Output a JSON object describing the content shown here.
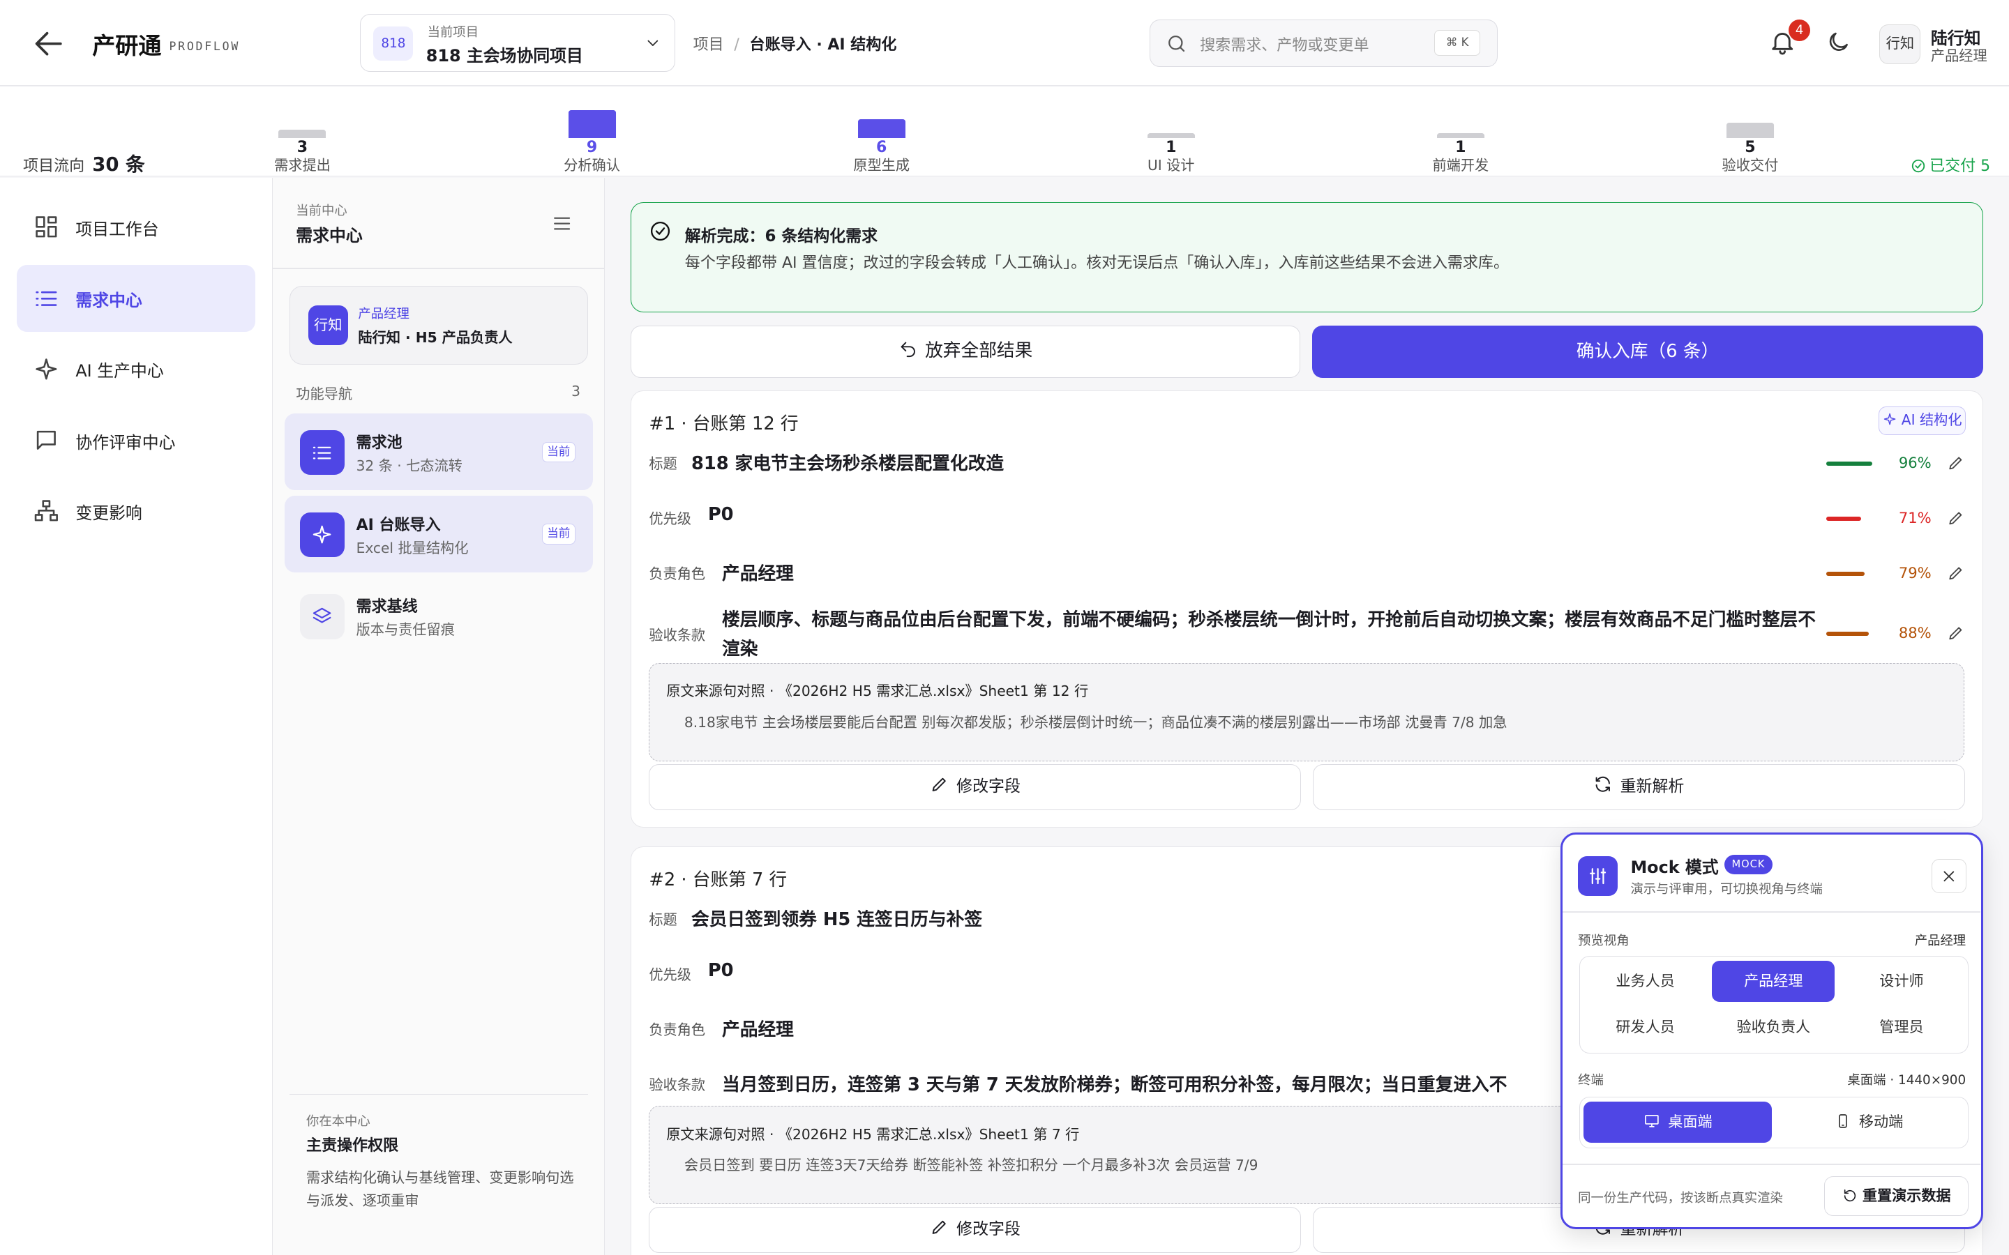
{
  "header": {
    "brand": "产研通",
    "brand_en": "PRODFLOW",
    "project_badge": "818",
    "project_label": "当前项目",
    "project_name": "818 主会场协同项目",
    "breadcrumb": [
      "项目",
      "台账导入 · AI 结构化"
    ],
    "search_placeholder": "搜索需求、产物或变更单",
    "search_shortcut": "⌘ K",
    "notification_count": "4",
    "user_avatar": "行知",
    "user_name": "陆行知",
    "user_role": "产品经理"
  },
  "flow": {
    "label": "项目流向",
    "total": "30 条",
    "stages": [
      {
        "name": "需求提出",
        "count": "3",
        "value": 3,
        "active": false
      },
      {
        "name": "分析确认",
        "count": "9",
        "value": 9,
        "active": true
      },
      {
        "name": "原型生成",
        "count": "6",
        "value": 6,
        "active": true
      },
      {
        "name": "UI 设计",
        "count": "1",
        "value": 1,
        "active": false
      },
      {
        "name": "前端开发",
        "count": "1",
        "value": 1,
        "active": false
      },
      {
        "name": "验收交付",
        "count": "5",
        "value": 5,
        "active": false
      }
    ],
    "delivered": "已交付 5",
    "colors": {
      "active": "#5b4fe8",
      "inactive": "#cfcfd3"
    }
  },
  "sidebar": {
    "items": [
      {
        "label": "项目工作台",
        "icon": "grid-icon",
        "active": false
      },
      {
        "label": "需求中心",
        "icon": "list-icon",
        "active": true
      },
      {
        "label": "AI 生产中心",
        "icon": "sparkle-icon",
        "active": false
      },
      {
        "label": "协作评审中心",
        "icon": "chat-icon",
        "active": false
      },
      {
        "label": "变更影响",
        "icon": "hierarchy-icon",
        "active": false
      }
    ]
  },
  "panel": {
    "label": "当前中心",
    "title": "需求中心",
    "role_avatar": "行知",
    "role_label": "产品经理",
    "role_name": "陆行知 · H5 产品负责人",
    "func_nav_label": "功能导航",
    "func_nav_count": "3",
    "items": [
      {
        "title": "需求池",
        "sub": "32 条 · 七态流转",
        "tag": "当前",
        "icon": "list-icon"
      },
      {
        "title": "AI 台账导入",
        "sub": "Excel 批量结构化",
        "tag": "当前",
        "icon": "sparkle-icon"
      },
      {
        "title": "需求基线",
        "sub": "版本与责任留痕",
        "tag": "",
        "icon": "layers-icon"
      }
    ],
    "footer_label": "你在本中心",
    "footer_title": "主责操作权限",
    "footer_desc": "需求结构化确认与基线管理、变更影响句选与派发、逐项重审"
  },
  "main": {
    "alert_title": "解析完成：6 条结构化需求",
    "alert_desc": "每个字段都带 AI 置信度；改过的字段会转成「人工确认」。核对无误后点「确认入库」，入库前这些结果不会进入需求库。",
    "discard_label": "放弃全部结果",
    "confirm_label": "确认入库（6 条）",
    "field_labels": {
      "title": "标题",
      "priority": "优先级",
      "owner": "负责角色",
      "acceptance": "验收条款"
    },
    "ai_tag": "AI 结构化",
    "edit_label": "修改字段",
    "reparse_label": "重新解析",
    "cards": [
      {
        "header": "#1  ·  台账第  12  行",
        "title": "818 家电节主会场秒杀楼层配置化改造",
        "priority": "P0",
        "owner": "产品经理",
        "acceptance": "楼层顺序、标题与商品位由后台配置下发，前端不硬编码；秒杀楼层统一倒计时，开抢前后自动切换文案；楼层有效商品不足门槛时整层不渲染",
        "conf": [
          {
            "pct": "96%",
            "value": 0.96,
            "color": "#15803d"
          },
          {
            "pct": "71%",
            "value": 0.71,
            "color": "#dc2626"
          },
          {
            "pct": "79%",
            "value": 0.79,
            "color": "#b45309"
          },
          {
            "pct": "88%",
            "value": 0.88,
            "color": "#b45309"
          }
        ],
        "source_title": "原文来源句对照 · 《2026H2 H5 需求汇总.xlsx》Sheet1 第 12 行",
        "source_quote": "8.18家电节 主会场楼层要能后台配置 别每次都发版；秒杀楼层倒计时统一；商品位凑不满的楼层别露出——市场部 沈曼青 7/8 加急"
      },
      {
        "header": "#2  ·  台账第  7  行",
        "title": "会员日签到领券 H5 连签日历与补签",
        "priority": "P0",
        "owner": "产品经理",
        "acceptance": "当月签到日历，连签第 3 天与第 7 天发放阶梯券；断签可用积分补签，每月限次；当日重复进入不",
        "source_title": "原文来源句对照 · 《2026H2 H5 需求汇总.xlsx》Sheet1 第 7 行",
        "source_quote": "会员日签到 要日历 连签3天7天给券 断签能补签 补签扣积分 一个月最多补3次 会员运营 7/9"
      }
    ]
  },
  "mock": {
    "title": "Mock 模式",
    "badge": "MOCK",
    "subtitle": "演示与评审用，可切换视角与终端",
    "view_label": "预览视角",
    "view_value": "产品经理",
    "roles": [
      "业务人员",
      "产品经理",
      "设计师",
      "研发人员",
      "验收负责人",
      "管理员"
    ],
    "selected_role": "产品经理",
    "terminal_label": "终端",
    "terminal_value": "桌面端 · 1440×900",
    "terminals": [
      "桌面端",
      "移动端"
    ],
    "footer_text": "同一份生产代码，按该断点真实渲染",
    "reset_label": "重置演示数据"
  },
  "colors": {
    "accent": "#4f46e5",
    "success": "#16a34a",
    "danger": "#d92d20"
  }
}
